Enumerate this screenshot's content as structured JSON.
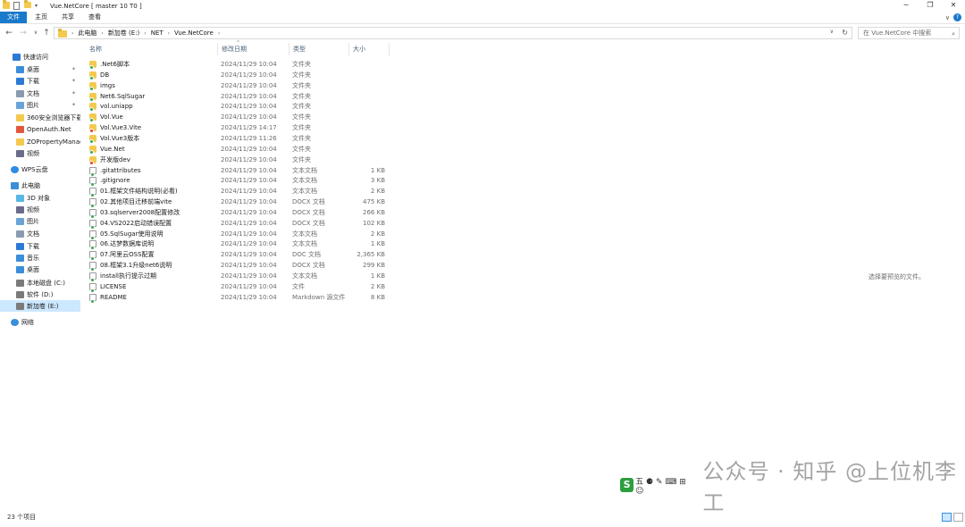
{
  "window": {
    "title": "Vue.NetCore [ master 10 T0 ]",
    "controls": {
      "minimize": "─",
      "maximize": "❐",
      "close": "✕"
    }
  },
  "ribbon": {
    "tabs": [
      {
        "label": "文件",
        "active": true
      },
      {
        "label": "主页",
        "active": false
      },
      {
        "label": "共享",
        "active": false
      },
      {
        "label": "查看",
        "active": false
      }
    ],
    "expand_glyph": "∨",
    "help_glyph": "?"
  },
  "navigation": {
    "back": "←",
    "forward": "→",
    "recent": "∨",
    "up": "↑",
    "breadcrumb": [
      "此电脑",
      "新加卷 (E:)",
      "NET",
      "Vue.NetCore"
    ],
    "separator": "›",
    "refresh_glyph": "↻",
    "dropdown_glyph": "∨"
  },
  "search": {
    "placeholder": "在 Vue.NetCore 中搜索",
    "icon": "search-icon"
  },
  "sidebar": {
    "items": [
      {
        "label": "快速访问",
        "icon": "star-icon",
        "pinned": false,
        "selected": false
      },
      {
        "label": "桌面",
        "icon": "desktop-icon",
        "pinned": true,
        "selected": false
      },
      {
        "label": "下载",
        "icon": "download-icon",
        "pinned": true,
        "selected": false
      },
      {
        "label": "文档",
        "icon": "document-icon",
        "pinned": true,
        "selected": false
      },
      {
        "label": "图片",
        "icon": "picture-icon",
        "pinned": true,
        "selected": false
      },
      {
        "label": "360安全浏览器下载",
        "icon": "folder-icon",
        "pinned": false,
        "selected": false
      },
      {
        "label": "OpenAuth.Net",
        "icon": "repo-folder-icon",
        "pinned": false,
        "selected": false
      },
      {
        "label": "ZOPropertyManag",
        "icon": "folder-icon",
        "pinned": false,
        "selected": false
      },
      {
        "label": "视频",
        "icon": "video-icon",
        "pinned": false,
        "selected": false
      },
      {
        "label": "WPS云盘",
        "icon": "cloud-icon",
        "pinned": false,
        "selected": false
      },
      {
        "label": "此电脑",
        "icon": "computer-icon",
        "pinned": false,
        "selected": false
      },
      {
        "label": "3D 对象",
        "icon": "cube-icon",
        "pinned": false,
        "selected": false
      },
      {
        "label": "视频",
        "icon": "video-icon",
        "pinned": false,
        "selected": false
      },
      {
        "label": "图片",
        "icon": "picture-icon",
        "pinned": false,
        "selected": false
      },
      {
        "label": "文档",
        "icon": "document-icon",
        "pinned": false,
        "selected": false
      },
      {
        "label": "下载",
        "icon": "download-icon",
        "pinned": false,
        "selected": false
      },
      {
        "label": "音乐",
        "icon": "music-icon",
        "pinned": false,
        "selected": false
      },
      {
        "label": "桌面",
        "icon": "desktop-icon",
        "pinned": false,
        "selected": false
      },
      {
        "label": "本地磁盘 (C:)",
        "icon": "drive-icon",
        "pinned": false,
        "selected": false
      },
      {
        "label": "软件 (D:)",
        "icon": "drive-icon",
        "pinned": false,
        "selected": false
      },
      {
        "label": "新加卷 (E:)",
        "icon": "drive-icon",
        "pinned": false,
        "selected": true
      },
      {
        "label": "网络",
        "icon": "network-icon",
        "pinned": false,
        "selected": false
      }
    ],
    "pin_glyph": "📌"
  },
  "columns": {
    "name": "名称",
    "date": "修改日期",
    "type": "类型",
    "size": "大小",
    "sort_glyph": "^"
  },
  "files": [
    {
      "name": ".Net6脚本",
      "date": "2024/11/29 10:04",
      "type": "文件夹",
      "size": "",
      "kind": "folder",
      "status": "green"
    },
    {
      "name": "DB",
      "date": "2024/11/29 10:04",
      "type": "文件夹",
      "size": "",
      "kind": "folder",
      "status": "green"
    },
    {
      "name": "imgs",
      "date": "2024/11/29 10:04",
      "type": "文件夹",
      "size": "",
      "kind": "folder",
      "status": "green"
    },
    {
      "name": "Net6.SqlSugar",
      "date": "2024/11/29 10:04",
      "type": "文件夹",
      "size": "",
      "kind": "folder",
      "status": "green"
    },
    {
      "name": "vol.uniapp",
      "date": "2024/11/29 10:04",
      "type": "文件夹",
      "size": "",
      "kind": "folder",
      "status": "green"
    },
    {
      "name": "Vol.Vue",
      "date": "2024/11/29 10:04",
      "type": "文件夹",
      "size": "",
      "kind": "folder",
      "status": "green"
    },
    {
      "name": "Vol.Vue3.Vite",
      "date": "2024/11/29 14:17",
      "type": "文件夹",
      "size": "",
      "kind": "folder",
      "status": "red"
    },
    {
      "name": "Vol.Vue3版本",
      "date": "2024/11/29 11:26",
      "type": "文件夹",
      "size": "",
      "kind": "folder",
      "status": "green"
    },
    {
      "name": "Vue.Net",
      "date": "2024/11/29 10:04",
      "type": "文件夹",
      "size": "",
      "kind": "folder",
      "status": "green"
    },
    {
      "name": "开发版dev",
      "date": "2024/11/29 10:04",
      "type": "文件夹",
      "size": "",
      "kind": "folder",
      "status": "red"
    },
    {
      "name": ".gitattributes",
      "date": "2024/11/29 10:04",
      "type": "文本文档",
      "size": "1 KB",
      "kind": "file",
      "status": "green"
    },
    {
      "name": ".gitignore",
      "date": "2024/11/29 10:04",
      "type": "文本文档",
      "size": "3 KB",
      "kind": "file",
      "status": "green"
    },
    {
      "name": "01.框架文件结构说明(必看)",
      "date": "2024/11/29 10:04",
      "type": "文本文档",
      "size": "2 KB",
      "kind": "file",
      "status": "green"
    },
    {
      "name": "02.其他项目迁移前端vite",
      "date": "2024/11/29 10:04",
      "type": "DOCX 文档",
      "size": "475 KB",
      "kind": "file",
      "status": "green"
    },
    {
      "name": "03.sqlserver2008配置修改",
      "date": "2024/11/29 10:04",
      "type": "DOCX 文档",
      "size": "266 KB",
      "kind": "file",
      "status": "green"
    },
    {
      "name": "04.VS2022启动错误配置",
      "date": "2024/11/29 10:04",
      "type": "DOCX 文档",
      "size": "102 KB",
      "kind": "file",
      "status": "green"
    },
    {
      "name": "05.SqlSugar使用说明",
      "date": "2024/11/29 10:04",
      "type": "文本文档",
      "size": "2 KB",
      "kind": "file",
      "status": "green"
    },
    {
      "name": "06.达梦数据库说明",
      "date": "2024/11/29 10:04",
      "type": "文本文档",
      "size": "1 KB",
      "kind": "file",
      "status": "green"
    },
    {
      "name": "07.阿里云OSS配置",
      "date": "2024/11/29 10:04",
      "type": "DOC 文档",
      "size": "2,365 KB",
      "kind": "file",
      "status": "green"
    },
    {
      "name": "08.框架3.1升级net6说明",
      "date": "2024/11/29 10:04",
      "type": "DOCX 文档",
      "size": "299 KB",
      "kind": "file",
      "status": "green"
    },
    {
      "name": "install执行提示过期",
      "date": "2024/11/29 10:04",
      "type": "文本文档",
      "size": "1 KB",
      "kind": "file",
      "status": "green"
    },
    {
      "name": "LICENSE",
      "date": "2024/11/29 10:04",
      "type": "文件",
      "size": "2 KB",
      "kind": "file",
      "status": "green"
    },
    {
      "name": "README",
      "date": "2024/11/29 10:04",
      "type": "Markdown 源文件",
      "size": "8 KB",
      "kind": "file",
      "status": "green"
    }
  ],
  "preview": {
    "message": "选择要预览的文件。"
  },
  "status": {
    "count": "23 个项目"
  },
  "watermark": {
    "logo_char": "S",
    "ime": "五 ⚈ ✎ ⌨ ⊞ ☺",
    "text": "公众号 · 知乎 @上位机李工"
  },
  "colors": {
    "accent": "#1979ca",
    "selected": "#cce8ff",
    "folder": "#f3c94e",
    "git_ok": "#34a853",
    "git_modified": "#e53935"
  }
}
